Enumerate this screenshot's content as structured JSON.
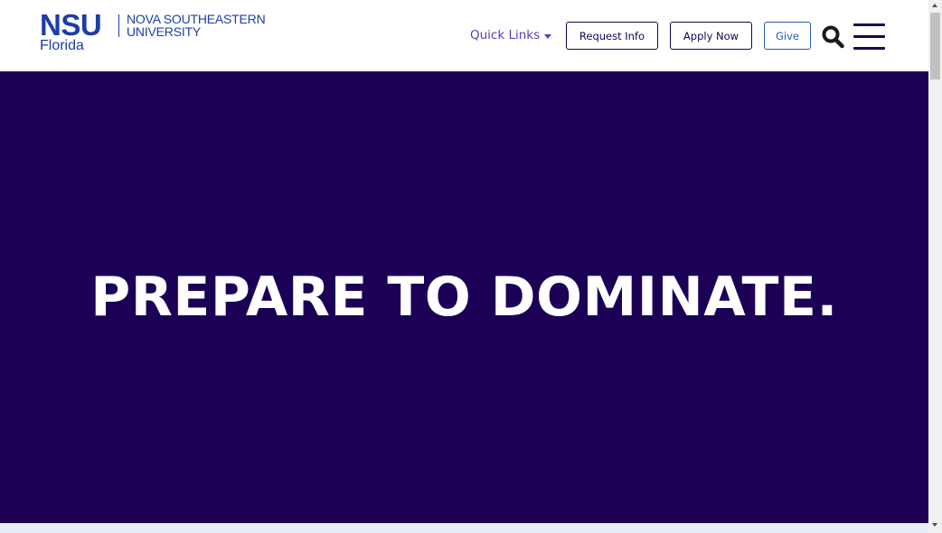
{
  "logo": {
    "wordmark": "NSU",
    "subtitle": "Florida",
    "university_line1": "NOVA SOUTHEASTERN",
    "university_line2": "UNIVERSITY"
  },
  "nav": {
    "quick_links_label": "Quick Links",
    "request_info_label": "Request Info",
    "apply_now_label": "Apply Now",
    "give_label": "Give",
    "search_icon": "search-icon",
    "menu_icon": "hamburger-menu-icon"
  },
  "hero": {
    "headline": "PREPARE TO DOMINATE."
  },
  "colors": {
    "brand_navy": "#1b0055",
    "logo_blue": "#1d3ea6",
    "link_purple": "#5b3db8",
    "give_blue": "#2a5db0"
  }
}
